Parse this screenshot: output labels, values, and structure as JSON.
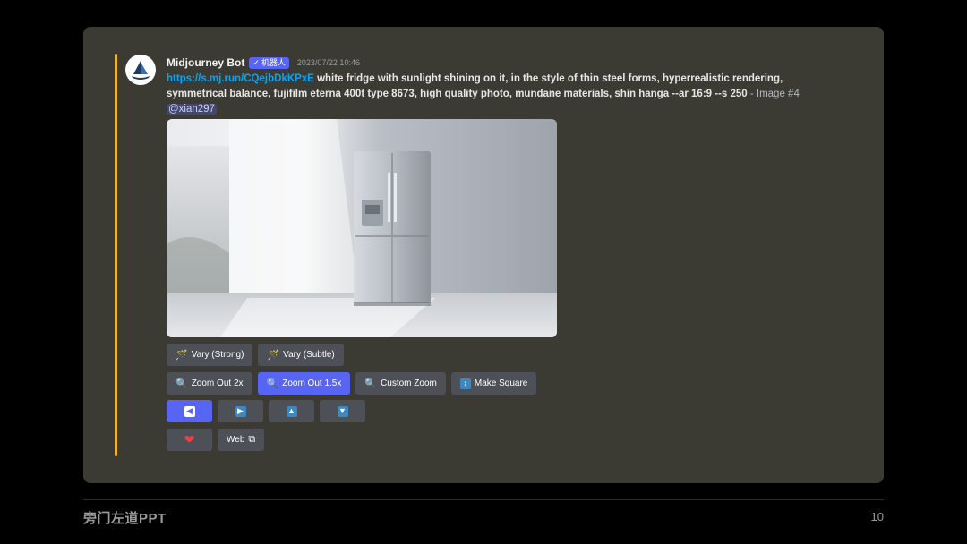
{
  "message": {
    "username": "Midjourney Bot",
    "bot_badge": "机器人",
    "timestamp": "2023/07/22 10:46",
    "link": "https://s.mj.run/CQejbDkKPxE",
    "prompt": "white fridge with sunlight shining on it, in the style of thin steel forms, hyperrealistic rendering, symmetrical balance, fujifilm eterna 400t type 8673, high quality photo, mundane materials, shin hanga --ar 16:9 --s 250",
    "suffix": " - Image #4 ",
    "mention": "@xian297"
  },
  "buttons": {
    "row1": [
      {
        "label": "Vary (Strong)",
        "icon": "magic-wand-icon"
      },
      {
        "label": "Vary (Subtle)",
        "icon": "magic-wand-icon"
      }
    ],
    "row2": [
      {
        "label": "Zoom Out 2x",
        "icon": "magnifier-icon"
      },
      {
        "label": "Zoom Out 1.5x",
        "icon": "magnifier-icon"
      },
      {
        "label": "Custom Zoom",
        "icon": "magnifier-icon"
      },
      {
        "label": "Make Square",
        "icon": "up-down-arrow-icon"
      }
    ],
    "row3": [
      {
        "icon": "arrow-left-icon",
        "glyph": "🡄"
      },
      {
        "icon": "arrow-right-icon",
        "glyph": "🡆"
      },
      {
        "icon": "arrow-up-icon",
        "glyph": "🡅"
      },
      {
        "icon": "arrow-down-icon",
        "glyph": "🡇"
      }
    ],
    "row4": [
      {
        "icon": "heart-icon"
      },
      {
        "label": "Web",
        "icon": "external-link-icon"
      }
    ]
  },
  "footer": {
    "brand": "旁门左道PPT",
    "page_number": "10"
  },
  "colors": {
    "panel": "#3c3b33",
    "accent": "#f0b232",
    "primary_button": "#5865f2",
    "secondary_button": "#4e5058",
    "link": "#00a8fc"
  }
}
